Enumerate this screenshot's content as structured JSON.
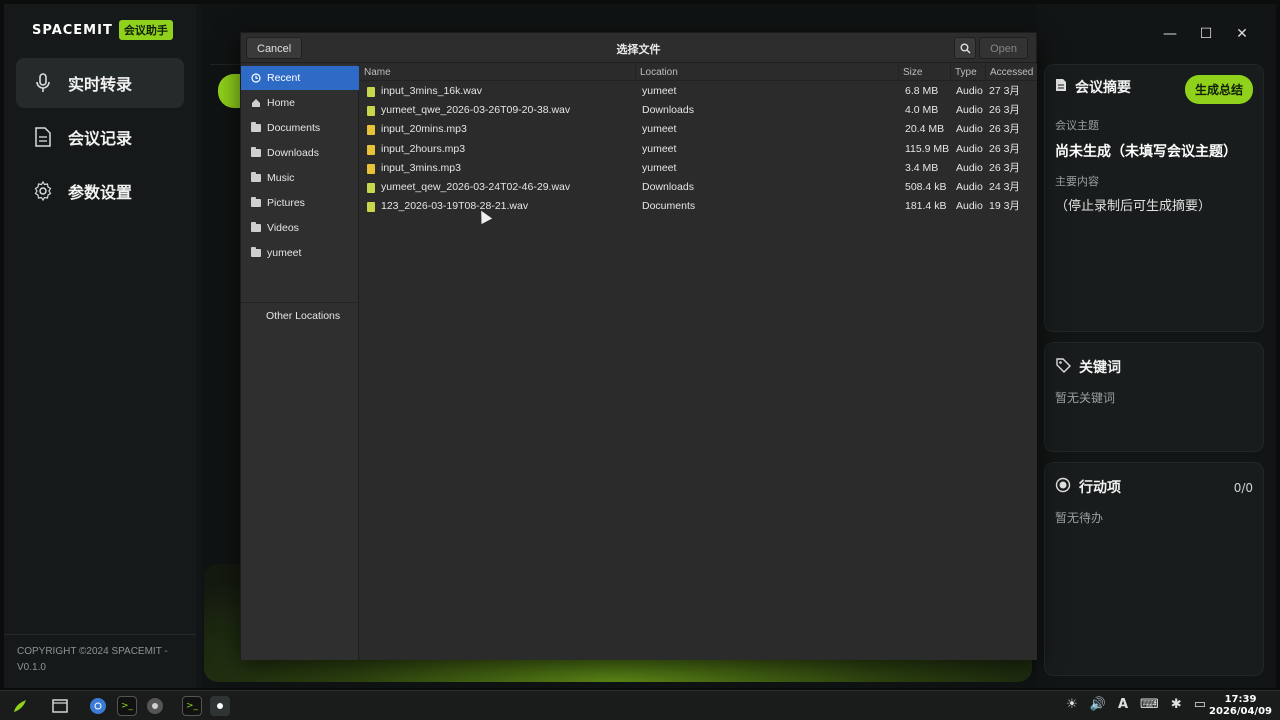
{
  "app": {
    "brand": "SPACEMIT",
    "badge": "会议助手",
    "nav": [
      {
        "label": "实时转录",
        "icon": "microphone-icon"
      },
      {
        "label": "会议记录",
        "icon": "document-icon"
      },
      {
        "label": "参数设置",
        "icon": "gear-icon"
      }
    ],
    "copyright_line1": "COPYRIGHT ©2024 SPACEMIT -",
    "copyright_line2": "V0.1.0"
  },
  "summary_panel": {
    "title": "会议摘要",
    "generate_button": "生成总结",
    "topic_label": "会议主题",
    "topic_value": "尚未生成（未填写会议主题）",
    "content_label": "主要内容",
    "content_value": "（停止录制后可生成摘要）"
  },
  "keywords_panel": {
    "title": "关键词",
    "empty_text": "暂无关键词"
  },
  "actions_panel": {
    "title": "行动项",
    "count": "0/0",
    "empty_text": "暂无待办"
  },
  "dialog": {
    "title": "选择文件",
    "cancel_label": "Cancel",
    "open_label": "Open",
    "places": [
      "Recent",
      "Home",
      "Documents",
      "Downloads",
      "Music",
      "Pictures",
      "Videos",
      "yumeet"
    ],
    "other_locations": "Other Locations",
    "columns": {
      "name": "Name",
      "location": "Location",
      "size": "Size",
      "type": "Type",
      "accessed": "Accessed"
    },
    "files": [
      {
        "name": "input_3mins_16k.wav",
        "location": "yumeet",
        "size": "6.8 MB",
        "type": "Audio",
        "accessed": "27 3月",
        "kind": "wav"
      },
      {
        "name": "yumeet_qwe_2026-03-26T09-20-38.wav",
        "location": "Downloads",
        "size": "4.0 MB",
        "type": "Audio",
        "accessed": "26 3月",
        "kind": "wav"
      },
      {
        "name": "input_20mins.mp3",
        "location": "yumeet",
        "size": "20.4 MB",
        "type": "Audio",
        "accessed": "26 3月",
        "kind": "mp3"
      },
      {
        "name": "input_2hours.mp3",
        "location": "yumeet",
        "size": "115.9 MB",
        "type": "Audio",
        "accessed": "26 3月",
        "kind": "mp3"
      },
      {
        "name": "input_3mins.mp3",
        "location": "yumeet",
        "size": "3.4 MB",
        "type": "Audio",
        "accessed": "26 3月",
        "kind": "mp3"
      },
      {
        "name": "yumeet_qew_2026-03-24T02-46-29.wav",
        "location": "Downloads",
        "size": "508.4 kB",
        "type": "Audio",
        "accessed": "24 3月",
        "kind": "wav"
      },
      {
        "name": "123_2026-03-19T08-28-21.wav",
        "location": "Documents",
        "size": "181.4 kB",
        "type": "Audio",
        "accessed": "19 3月",
        "kind": "wav"
      }
    ]
  },
  "taskbar": {
    "time": "17:39",
    "date": "2026/04/09",
    "keyboard": "A"
  },
  "colors": {
    "accent": "#8fd11b",
    "selection": "#2e6bc6"
  }
}
